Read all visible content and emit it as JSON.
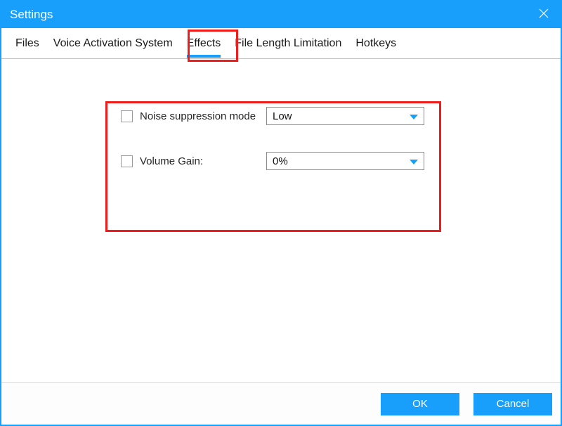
{
  "window": {
    "title": "Settings"
  },
  "tabs": {
    "items": [
      {
        "label": "Files"
      },
      {
        "label": "Voice Activation System"
      },
      {
        "label": "Effects"
      },
      {
        "label": "File Length Limitation"
      },
      {
        "label": "Hotkeys"
      }
    ],
    "active_index": 2
  },
  "effects": {
    "noise_suppression": {
      "label": "Noise suppression mode",
      "value": "Low",
      "checked": false
    },
    "volume_gain": {
      "label": "Volume Gain:",
      "value": "0%",
      "checked": false
    }
  },
  "buttons": {
    "ok": "OK",
    "cancel": "Cancel"
  },
  "colors": {
    "accent": "#179ffb",
    "highlight": "#ef1c1c"
  }
}
